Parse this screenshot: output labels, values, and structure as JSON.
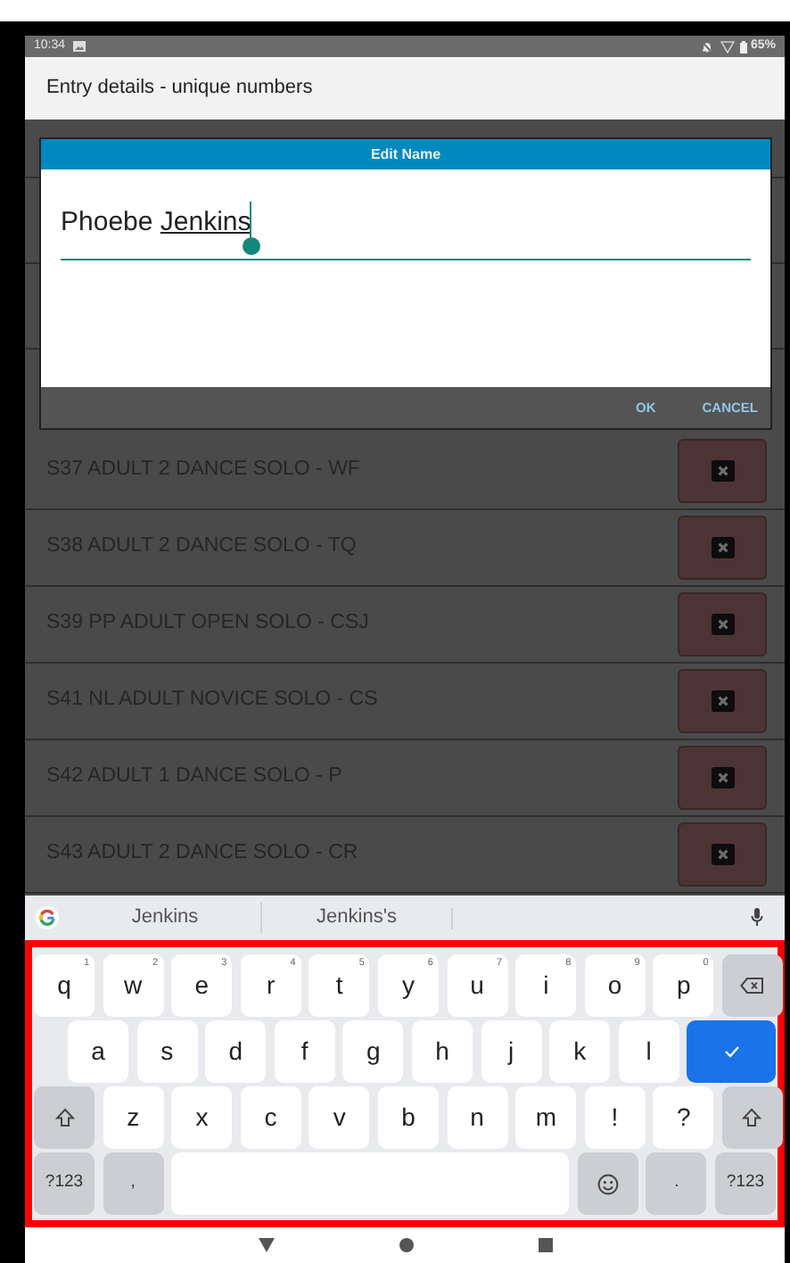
{
  "status_bar": {
    "time": "10:34",
    "battery": "65%"
  },
  "app_bar": {
    "title": "Entry details - unique numbers"
  },
  "dialog": {
    "title": "Edit Name",
    "field_parts": [
      {
        "text": "Phoebe ",
        "underlined": false
      },
      {
        "text": "Jenkins",
        "underlined": true
      }
    ],
    "buttons": [
      "OK",
      "CANCEL"
    ]
  },
  "entries": [
    {
      "label": "S37 ADULT 2 DANCE SOLO - WF"
    },
    {
      "label": "S38 ADULT 2 DANCE SOLO - TQ"
    },
    {
      "label": "S39 PP ADULT OPEN SOLO - CSJ"
    },
    {
      "label": "S41 NL ADULT NOVICE SOLO - CS"
    },
    {
      "label": "S42 ADULT 1 DANCE SOLO - P"
    },
    {
      "label": "S43 ADULT 2 DANCE SOLO - CR"
    }
  ],
  "keyboard": {
    "suggestions": [
      "Jenkins",
      "Jenkins's"
    ],
    "rows": [
      [
        {
          "kind": "char",
          "label": "q",
          "hint": "1"
        },
        {
          "kind": "char",
          "label": "w",
          "hint": "2"
        },
        {
          "kind": "char",
          "label": "e",
          "hint": "3"
        },
        {
          "kind": "char",
          "label": "r",
          "hint": "4"
        },
        {
          "kind": "char",
          "label": "t",
          "hint": "5"
        },
        {
          "kind": "char",
          "label": "y",
          "hint": "6"
        },
        {
          "kind": "char",
          "label": "u",
          "hint": "7"
        },
        {
          "kind": "char",
          "label": "i",
          "hint": "8"
        },
        {
          "kind": "char",
          "label": "o",
          "hint": "9"
        },
        {
          "kind": "char",
          "label": "p",
          "hint": "0"
        },
        {
          "kind": "backspace"
        }
      ],
      [
        {
          "kind": "char",
          "label": "a"
        },
        {
          "kind": "char",
          "label": "s"
        },
        {
          "kind": "char",
          "label": "d"
        },
        {
          "kind": "char",
          "label": "f"
        },
        {
          "kind": "char",
          "label": "g"
        },
        {
          "kind": "char",
          "label": "h"
        },
        {
          "kind": "char",
          "label": "j"
        },
        {
          "kind": "char",
          "label": "k"
        },
        {
          "kind": "char",
          "label": "l"
        },
        {
          "kind": "enter"
        }
      ],
      [
        {
          "kind": "shift"
        },
        {
          "kind": "char",
          "label": "z"
        },
        {
          "kind": "char",
          "label": "x"
        },
        {
          "kind": "char",
          "label": "c"
        },
        {
          "kind": "char",
          "label": "v"
        },
        {
          "kind": "char",
          "label": "b"
        },
        {
          "kind": "char",
          "label": "n"
        },
        {
          "kind": "char",
          "label": "m"
        },
        {
          "kind": "char",
          "label": "!"
        },
        {
          "kind": "char",
          "label": "?"
        },
        {
          "kind": "shift"
        }
      ],
      [
        {
          "kind": "mod",
          "label": "?123"
        },
        {
          "kind": "mod",
          "label": ","
        },
        {
          "kind": "space"
        },
        {
          "kind": "emoji"
        },
        {
          "kind": "mod",
          "label": "."
        },
        {
          "kind": "mod",
          "label": "?123"
        }
      ]
    ]
  }
}
